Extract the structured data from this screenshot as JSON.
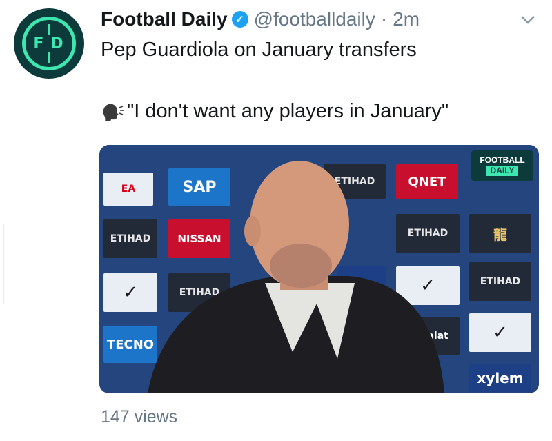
{
  "tweet": {
    "author_name": "Football Daily",
    "handle": "@footballdaily",
    "separator": "·",
    "time": "2m",
    "avatar_text": "FD",
    "line1": "Pep Guardiola on January transfers",
    "line2": "\"I don't want any players in January\"",
    "views": "147 views"
  },
  "media": {
    "badge_line1": "FOOTBALL",
    "badge_line2": "DAILY",
    "sponsors": [
      "EA",
      "SAP",
      "ETIHAD",
      "QNET",
      "NISSAN",
      "ETIHAD",
      "Sure",
      "ETIHAD",
      "TECNO",
      "etisalat",
      "xylem",
      "ETIHAD"
    ]
  },
  "colors": {
    "accent": "#1da1f2",
    "brand": "#3ee6b0",
    "muted": "#657786"
  }
}
